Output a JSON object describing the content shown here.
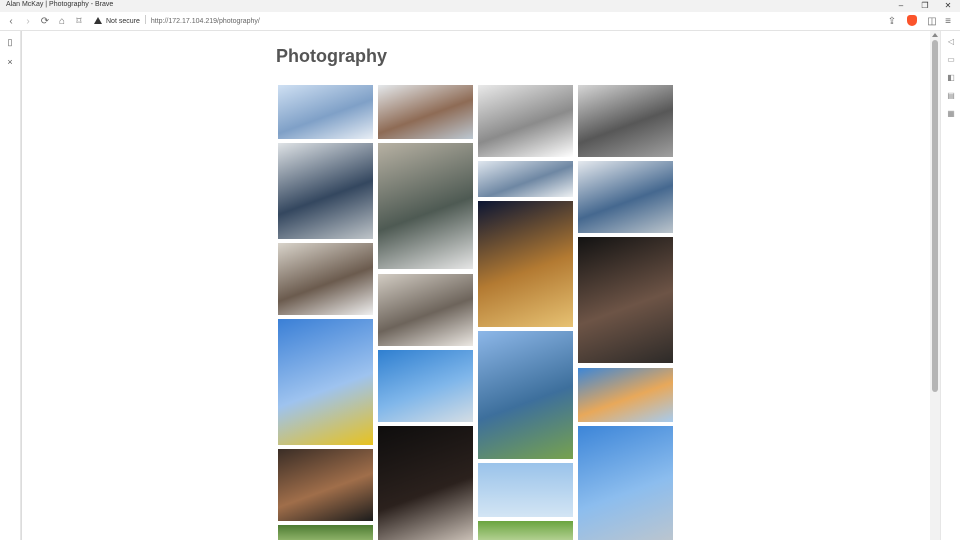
{
  "window": {
    "title": "Alan McKay | Photography - Brave",
    "controls": {
      "minimize": "–",
      "maximize": "❐",
      "close": "✕"
    }
  },
  "toolbar": {
    "back": "‹",
    "forward": "›",
    "reload": "⟳",
    "home": "⌂",
    "bookmark": "⌑",
    "security_label": "Not secure",
    "url": "http://172.17.104.219/photography/",
    "share": "⇪",
    "sidebar_toggle": "◫",
    "menu": "≡"
  },
  "left_sidebar": {
    "panel_icon": "▯",
    "close_icon": "×"
  },
  "right_sidebar": {
    "icons": [
      "◁",
      "▭",
      "◧",
      "▤",
      "▦"
    ]
  },
  "page": {
    "title": "Photography"
  },
  "gallery": {
    "photos": [
      {
        "name": "snowy-street-buildings",
        "colors": [
          "#cfe0f3",
          "#7fa0c7",
          "#e8eef5"
        ]
      },
      {
        "name": "snow-under-overpass",
        "colors": [
          "#dfe3e6",
          "#34475f",
          "#bfc5c9"
        ]
      },
      {
        "name": "limb-lab-storefront",
        "colors": [
          "#d9d4cb",
          "#6b5b4e",
          "#f0f0f0"
        ]
      },
      {
        "name": "hot-air-balloon-yellow",
        "colors": [
          "#3a7fd6",
          "#9ec3ef",
          "#e8c21e"
        ]
      },
      {
        "name": "night-courtyard",
        "colors": [
          "#3a2d26",
          "#a06e4a",
          "#1c1c1c"
        ]
      },
      {
        "name": "green-trees-bottom",
        "colors": [
          "#4d7b32",
          "#a2c47a"
        ]
      },
      {
        "name": "river-building-snow",
        "colors": [
          "#e4e8eb",
          "#8e6b55",
          "#bcc8d2"
        ]
      },
      {
        "name": "doorway-with-snow",
        "colors": [
          "#b7b1a3",
          "#4e5a53",
          "#e6e6e6"
        ]
      },
      {
        "name": "interior-lobby",
        "colors": [
          "#d2ccc3",
          "#6d645b",
          "#ece8e3"
        ]
      },
      {
        "name": "blue-sky-building",
        "colors": [
          "#2f7fd0",
          "#7fb6ea",
          "#d4dde4"
        ]
      },
      {
        "name": "dark-tunnel",
        "colors": [
          "#0e0d0d",
          "#2b211d",
          "#d8cec4"
        ]
      },
      {
        "name": "snowy-tree-branches",
        "colors": [
          "#e9e9e9",
          "#8b8b8b",
          "#ffffff"
        ]
      },
      {
        "name": "snowy-building-lot",
        "colors": [
          "#dfe6ee",
          "#6e87a3",
          "#eef1f3"
        ]
      },
      {
        "name": "night-alley-lights",
        "colors": [
          "#0b1533",
          "#b37a32",
          "#e7c273"
        ]
      },
      {
        "name": "flags-sign-street",
        "colors": [
          "#8db7e8",
          "#3d6f9c",
          "#77a24e"
        ]
      },
      {
        "name": "balloons-pale-sky",
        "colors": [
          "#9ac3ea",
          "#d3e5f4"
        ]
      },
      {
        "name": "green-foliage",
        "colors": [
          "#6aa43f",
          "#c4dba5"
        ]
      },
      {
        "name": "foggy-bridge",
        "colors": [
          "#d6d6d6",
          "#575757",
          "#a0a0a0"
        ]
      },
      {
        "name": "snowy-road-building",
        "colors": [
          "#e5e9ee",
          "#45688f",
          "#bcc5cc"
        ]
      },
      {
        "name": "window-figure-dark",
        "colors": [
          "#121212",
          "#6d5446",
          "#2d2a28"
        ]
      },
      {
        "name": "sunset-balloons",
        "colors": [
          "#3d86d6",
          "#e8a85a",
          "#a7cbee"
        ]
      },
      {
        "name": "diner-blue-sky",
        "colors": [
          "#3c85d8",
          "#8cbdee",
          "#bfc6cc"
        ]
      }
    ]
  }
}
